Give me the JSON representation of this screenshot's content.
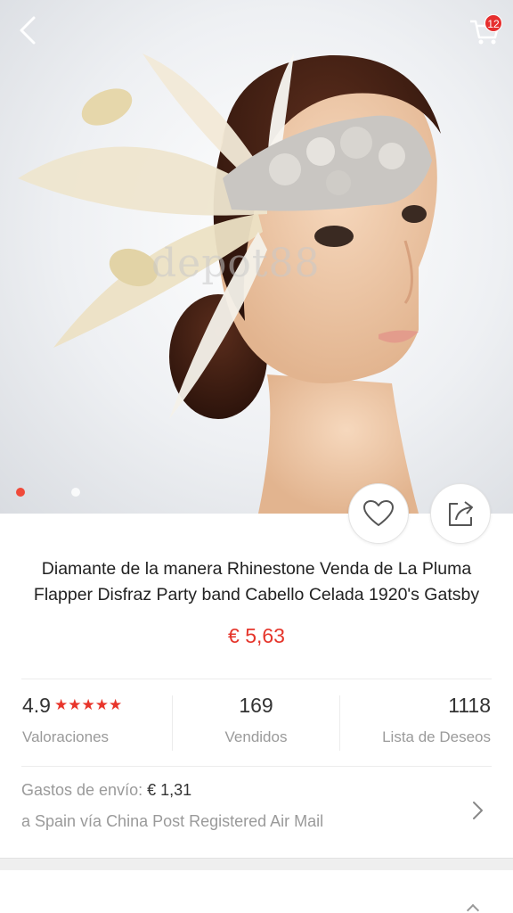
{
  "header": {
    "back_icon": "chevron-left-icon",
    "cart_icon": "shopping-cart-icon",
    "cart_badge": "12"
  },
  "gallery": {
    "watermark": "depot88",
    "total_images": 2,
    "active_index": 0
  },
  "actions": {
    "wishlist_icon": "heart-outline-icon",
    "share_icon": "share-icon"
  },
  "product": {
    "title": "Diamante de la manera Rhinestone Venda de La Pluma Flapper Disfraz Party band Cabello Celada 1920's Gatsby",
    "price": "€ 5,63"
  },
  "stats": {
    "rating_value": "4.9",
    "rating_stars": "★★★★★",
    "rating_label": "Valoraciones",
    "sold_value": "169",
    "sold_label": "Vendidos",
    "wishlist_value": "1118",
    "wishlist_label": "Lista de Deseos"
  },
  "shipping": {
    "label": "Gastos de envío:",
    "cost": "€ 1,31",
    "destination": "a Spain vía China Post Registered Air Mail"
  },
  "colors": {
    "accent": "#e5352b",
    "muted_text": "#9a9a9a",
    "divider": "#ececec"
  }
}
